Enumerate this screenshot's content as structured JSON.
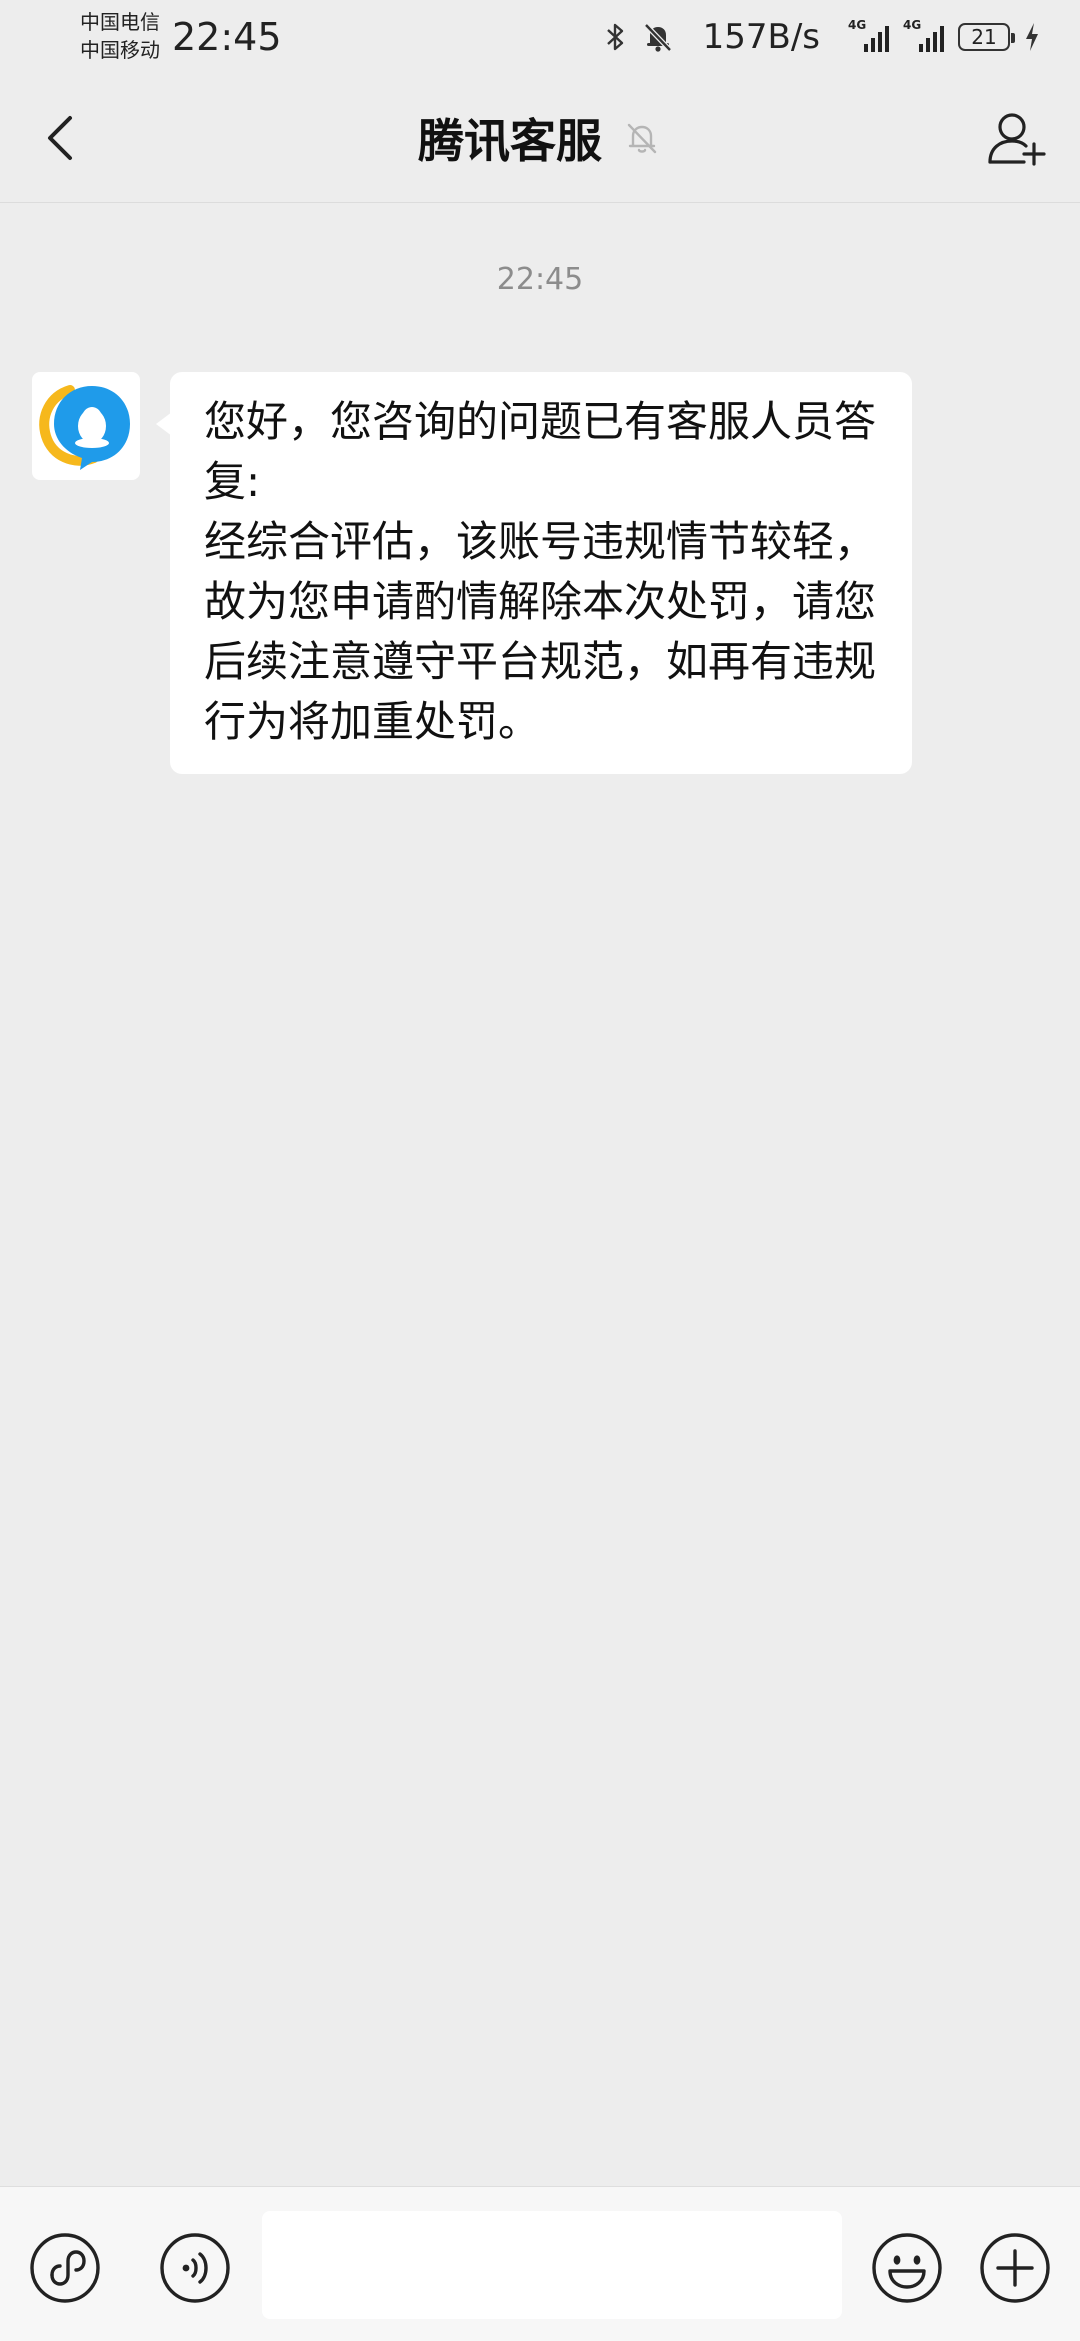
{
  "status_bar": {
    "carrier_1": "中国电信",
    "carrier_2": "中国移动",
    "time": "22:45",
    "net_speed": "157B/s",
    "signal_1_label": "4G",
    "signal_2_label": "4G",
    "battery_level": "21"
  },
  "header": {
    "title": "腾讯客服"
  },
  "chat": {
    "time": "22:45",
    "message": {
      "line_1": "您好，您咨询的问题已有客服人员答复:",
      "line_2": "经综合评估，该账号违规情节较轻，故为您申请酌情解除本次处罚，请您后续注意遵守平台规范，如再有违规行为将加重处罚。"
    }
  },
  "input_bar": {
    "placeholder": ""
  },
  "colors": {
    "background": "#ededed",
    "bubble": "#ffffff",
    "accent_blue": "#1f9bea",
    "accent_yellow": "#f6b81c"
  },
  "icons": {
    "back": "chevron-left-icon",
    "mute": "bell-off-icon",
    "add_friend": "person-plus-icon",
    "mini_program": "mini-program-icon",
    "voice": "voice-icon",
    "emoji": "smile-icon",
    "plus": "plus-icon"
  }
}
